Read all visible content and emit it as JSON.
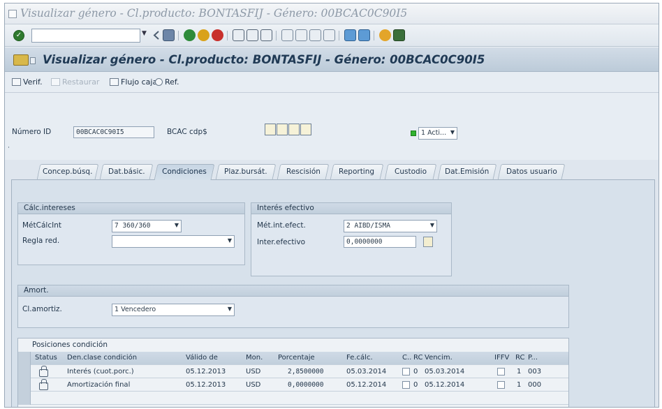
{
  "window": {
    "title": "Visualizar género - Cl.producto: BONTASFIJ - Género: 00BCAC0C90I5"
  },
  "header": {
    "title": "Visualizar género - Cl.producto: BONTASFIJ - Género: 00BCAC0C90I5"
  },
  "toolbar": {
    "check_label": "Verif.",
    "restore_label": "Restaurar",
    "cashflow_label": "Flujo caja",
    "ref_label": "Ref."
  },
  "fields": {
    "id_label": "Número ID",
    "id_value": "00BCAC0C90I5",
    "issuer_label": "BCAC cdp$",
    "status_value": "1 Acti..."
  },
  "tabs": [
    {
      "label": "Concep.búsq."
    },
    {
      "label": "Dat.básic."
    },
    {
      "label": "Condiciones"
    },
    {
      "label": "Plaz.bursát."
    },
    {
      "label": "Rescisión"
    },
    {
      "label": "Reporting"
    },
    {
      "label": "Custodio"
    },
    {
      "label": "Dat.Emisión"
    },
    {
      "label": "Datos usuario"
    }
  ],
  "active_tab": "Condiciones",
  "calc_interest": {
    "title": "Cálc.intereses",
    "method_label": "MétCálcInt",
    "method_value": "7 360/360",
    "rounding_label": "Regla red.",
    "rounding_value": ""
  },
  "effective_interest": {
    "title": "Interés efectivo",
    "method_label": "Mét.int.efect.",
    "method_value": "2 AIBD/ISMA",
    "rate_label": "Inter.efectivo",
    "rate_value": "0,0000000"
  },
  "amortization": {
    "title": "Amort.",
    "label": "Cl.amortiz.",
    "value": "1 Vencedero"
  },
  "conditions_table": {
    "title": "Posiciones condición",
    "columns": [
      "Status",
      "Den.clase condición",
      "Válido de",
      "Mon.",
      "Porcentaje",
      "Fe.cálc.",
      "C..",
      "RC",
      "Vencim.",
      "IFFV",
      "RC",
      "P..."
    ],
    "rows": [
      {
        "name": "Interés (cuot.porc.)",
        "valid_from": "05.12.2013",
        "currency": "USD",
        "percentage": "2,8500000",
        "calc_date": "05.03.2014",
        "rc": "0",
        "due": "05.03.2014",
        "rc2": "1",
        "p": "003"
      },
      {
        "name": "Amortización final",
        "valid_from": "05.12.2013",
        "currency": "USD",
        "percentage": "0,0000000",
        "calc_date": "05.12.2014",
        "rc": "0",
        "due": "05.12.2014",
        "rc2": "1",
        "p": "000"
      }
    ]
  },
  "colors": {
    "accent": "#203a55",
    "status_green": "#2fb32f",
    "panel_bg": "#d7e1eb"
  }
}
